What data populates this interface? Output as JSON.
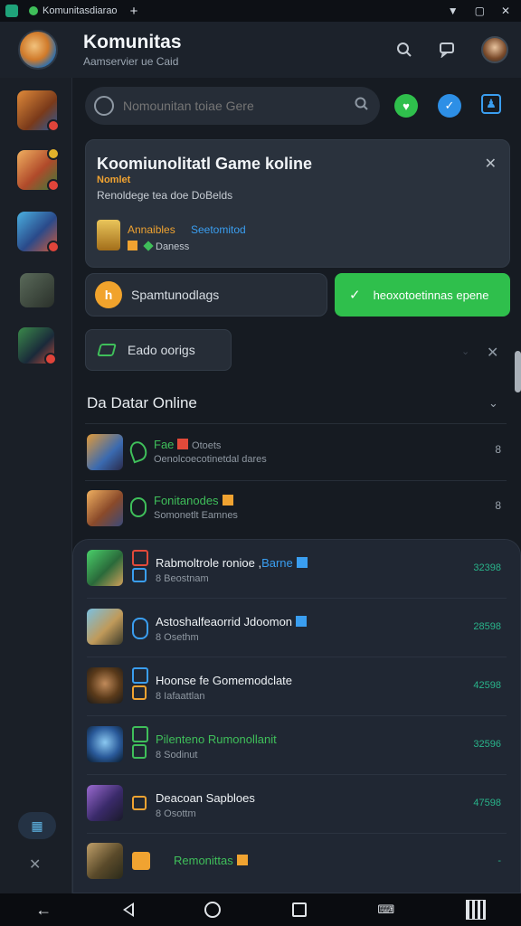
{
  "titlebar": {
    "tab_label": "Komunitasdiarao",
    "new_tab": "+",
    "wifi_icon": "wifi-icon",
    "maximize_icon": "square-icon",
    "close": "✕"
  },
  "header": {
    "title": "Komunitas",
    "subtitle": "Aamservier ue Caid"
  },
  "search": {
    "placeholder": "Nomounitan toiae Gere"
  },
  "featured": {
    "title": "Koomiunolitatl Game koline",
    "tag": "Nomlet",
    "description": "Renoldege tea doe DoBelds",
    "achievement_1": "Annaibles",
    "achievement_2": "Seetomitod",
    "meta": "Daness",
    "close": "✕"
  },
  "actions": {
    "join_label": "Spamtunodlags",
    "join_icon_text": "h",
    "online_label": "heoxotoetinnas epene",
    "check": "✓",
    "secondary_label": "Eado oorigs"
  },
  "online_section": {
    "title": "Da Datar Online",
    "chevron": "⌄",
    "close": "✕",
    "rows": [
      {
        "name": "Fae",
        "sub": "Oenolcoecotinetdal dares",
        "extra": "Otoets",
        "more": "8"
      },
      {
        "name": "Fonitanodes",
        "sub": "Somonetlt Eamnes",
        "extra": "",
        "more": "8"
      }
    ]
  },
  "games": [
    {
      "name": "Rabmoltrole ronioe",
      "link": "Barne",
      "sub": "8 Beostnam",
      "score": "32398"
    },
    {
      "name": "Astoshalfeaorrid Jdoomon",
      "link": "",
      "sub": "8 Osethm",
      "score": "28598"
    },
    {
      "name": "Hoonse fe Gomemodclate",
      "link": "",
      "sub": "8 Iafaattlan",
      "score": "42598"
    },
    {
      "name": "Pilenteno Rumonollanit",
      "link": "",
      "sub": "8 Sodinut",
      "score": "32596"
    },
    {
      "name": "Deacoan Sapbloes",
      "link": "",
      "sub": "8 Osottm",
      "score": "47598"
    },
    {
      "name": "Remonittas",
      "link": "",
      "sub": "",
      "score": "-"
    }
  ],
  "rail": {
    "grid_icon": "grid-icon",
    "close": "✕"
  },
  "navbar": {
    "back": "←",
    "keyboard": "⌨"
  },
  "colors": {
    "accent_green": "#2fbf4c",
    "accent_blue": "#3a9ef0",
    "accent_orange": "#f1a32c",
    "background": "#161b22"
  }
}
